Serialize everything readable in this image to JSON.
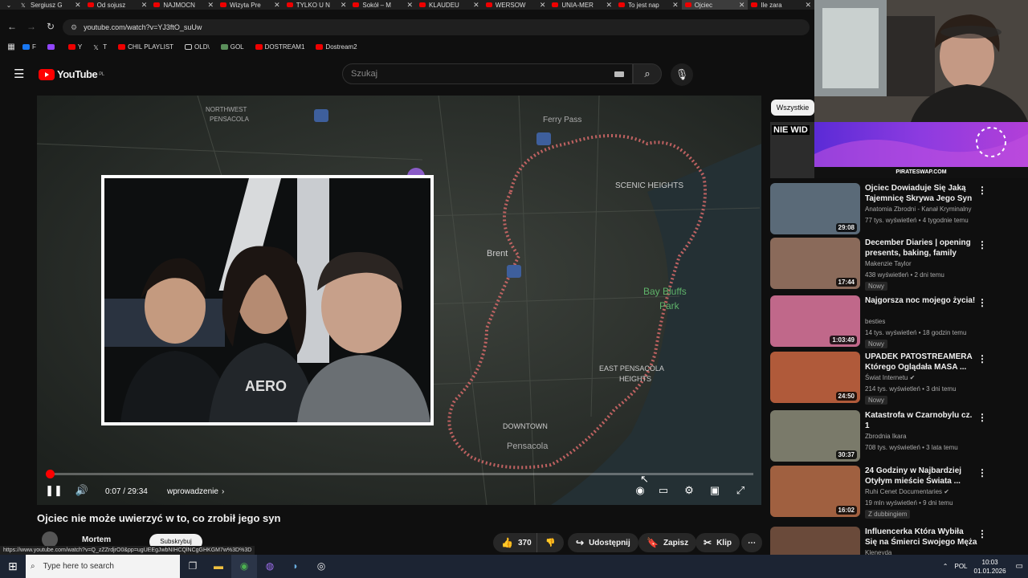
{
  "browser": {
    "tabs": [
      {
        "title": "Sergiusz G",
        "icon": "x-icon"
      },
      {
        "title": "Od sojusz",
        "icon": "youtube-icon"
      },
      {
        "title": "NAJMOCN",
        "icon": "youtube-icon"
      },
      {
        "title": "Wizyta Pre",
        "icon": "youtube-icon"
      },
      {
        "title": "TYLKO U N",
        "icon": "youtube-icon"
      },
      {
        "title": "Sokół – M",
        "icon": "youtube-icon"
      },
      {
        "title": "KLAUDEU",
        "icon": "youtube-icon"
      },
      {
        "title": "WERSOW",
        "icon": "youtube-icon"
      },
      {
        "title": "UNIA-MER",
        "icon": "youtube-icon"
      },
      {
        "title": "To jest nap",
        "icon": "youtube-icon"
      },
      {
        "title": "Ojciec",
        "icon": "youtube-icon",
        "active": true
      },
      {
        "title": "Ile zara",
        "icon": "youtube-icon"
      }
    ],
    "url": "youtube.com/watch?v=YJ3ftO_suUw",
    "bookmarks": [
      {
        "label": "F",
        "icon": "facebook-icon"
      },
      {
        "label": "",
        "icon": "twitch-icon"
      },
      {
        "label": "Y",
        "icon": "youtube-icon"
      },
      {
        "label": "T",
        "icon": "x-icon"
      },
      {
        "label": "CHIL PLAYLIST",
        "icon": "youtube-icon"
      },
      {
        "label": "OLD\\",
        "icon": "folder-icon"
      },
      {
        "label": "GOL",
        "icon": "gol-icon"
      },
      {
        "label": "DOSTREAM1",
        "icon": "youtube-icon"
      },
      {
        "label": "Dostream2",
        "icon": "youtube-icon"
      }
    ],
    "status_url": "https://www.youtube.com/watch?v=Q_zZZrdjrO0&pp=ugUEEgJwbNIHCQlNCgGHKGM7w%3D%3D"
  },
  "youtube": {
    "logo": "YouTube",
    "region": "PL",
    "search_placeholder": "Szukaj"
  },
  "player": {
    "time": "0:07 / 29:34",
    "chapter": "wprowadzenie",
    "progress": 0.004
  },
  "video": {
    "title": "Ojciec nie może uwierzyć w to, co zrobił jego syn",
    "channel": "Mortem",
    "subscribe": "Subskrybuj",
    "likes": "370",
    "share": "Udostępnij",
    "save": "Zapisz",
    "clip": "Klip"
  },
  "sidebar": {
    "chip": "Wszystkie",
    "ad_text": "NIE WID",
    "banner_text": "PIRATESWAP.COM",
    "recommendations": [
      {
        "title": "Ojciec Dowiaduje Się Jaką Tajemnicę Skrywa Jego Syn",
        "channel": "Anatomia Zbrodni - Kanał Kryminalny",
        "meta": "77 tys. wyświetleń • 4 tygodnie temu",
        "duration": "29:08",
        "badge": "",
        "verified": false,
        "color": "#5a6a78"
      },
      {
        "title": "December Diaries | opening presents, baking, family time, ...",
        "channel": "Makenzie Taylor",
        "meta": "438 wyświetleń • 2 dni temu",
        "duration": "17:44",
        "badge": "Nowy",
        "verified": false,
        "color": "#8a6a5a"
      },
      {
        "title": "Najgorsza noc mojego życia!",
        "channel": "besties",
        "meta": "14 tys. wyświetleń • 18 godzin temu",
        "duration": "1:03:49",
        "badge": "Nowy",
        "verified": false,
        "color": "#c0688a"
      },
      {
        "title": "UPADEK PATOSTREAMERA Którego Oglądała MASA ...",
        "channel": "Świat Internetu",
        "meta": "214 tys. wyświetleń • 3 dni temu",
        "duration": "24:50",
        "badge": "Nowy",
        "verified": true,
        "color": "#b05a3a"
      },
      {
        "title": "Katastrofa w Czarnobylu cz. 1",
        "channel": "Zbrodnia Ikara",
        "meta": "708 tys. wyświetleń • 3 lata temu",
        "duration": "30:37",
        "badge": "",
        "verified": false,
        "color": "#7a7a6a"
      },
      {
        "title": "24 Godziny w Najbardziej Otyłym mieście Świata ...",
        "channel": "Ruhi Cenet Documentaries",
        "meta": "19 mln wyświetleń • 9 dni temu",
        "duration": "16:02",
        "badge": "Z dubbingiem",
        "verified": true,
        "color": "#a06040"
      },
      {
        "title": "Influencerka Która Wybiła Się na Śmierci Swojego Męża",
        "channel": "Kleneyda",
        "meta": "",
        "duration": "",
        "badge": "",
        "verified": false,
        "color": "#6a4a3a"
      }
    ]
  },
  "taskbar": {
    "search_placeholder": "Type here to search",
    "lang": "POL",
    "time": "10:03",
    "date": "01.01.2026"
  }
}
